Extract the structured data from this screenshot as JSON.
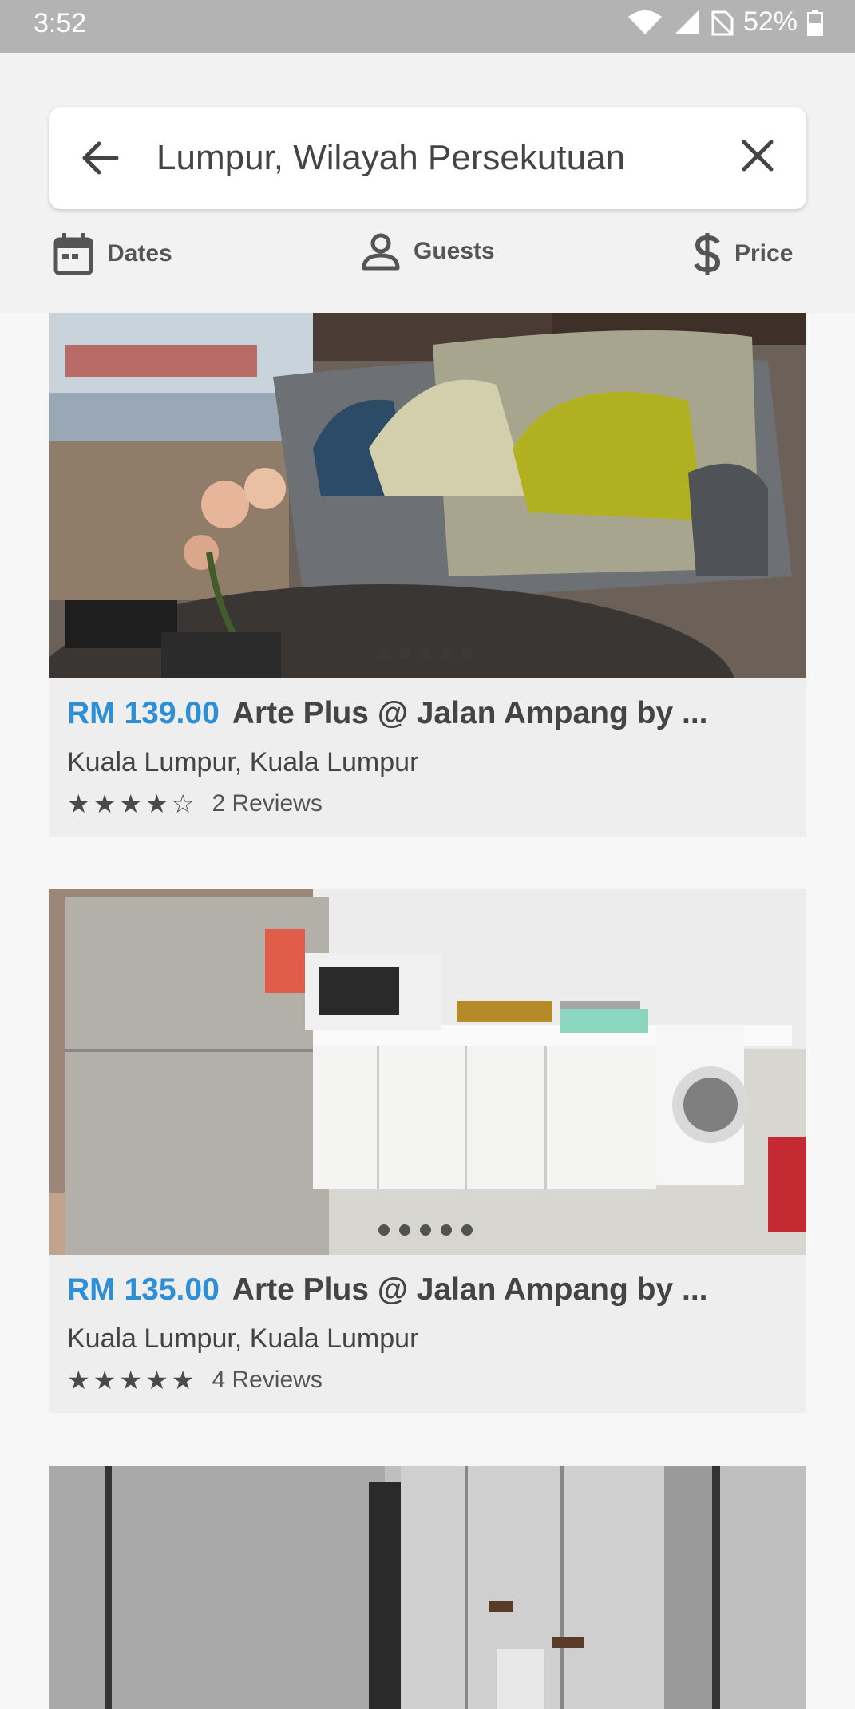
{
  "status_bar": {
    "time": "3:52",
    "battery": "52%"
  },
  "search": {
    "query": "Lumpur, Wilayah Persekutuan"
  },
  "filters": {
    "dates": "Dates",
    "guests": "Guests",
    "price": "Price"
  },
  "listings": [
    {
      "price": "RM 139.00",
      "title": "Arte Plus @ Jalan Ampang by ...",
      "location": "Kuala Lumpur, Kuala Lumpur",
      "rating": 4,
      "reviews": "2 Reviews",
      "photo_dots": 5
    },
    {
      "price": "RM 135.00",
      "title": "Arte Plus @ Jalan Ampang by ...",
      "location": "Kuala Lumpur, Kuala Lumpur",
      "rating": 5,
      "reviews": "4 Reviews",
      "photo_dots": 5
    }
  ],
  "colors": {
    "price_accent": "#2f8fd6",
    "status_bar": "#b3b3b3"
  }
}
